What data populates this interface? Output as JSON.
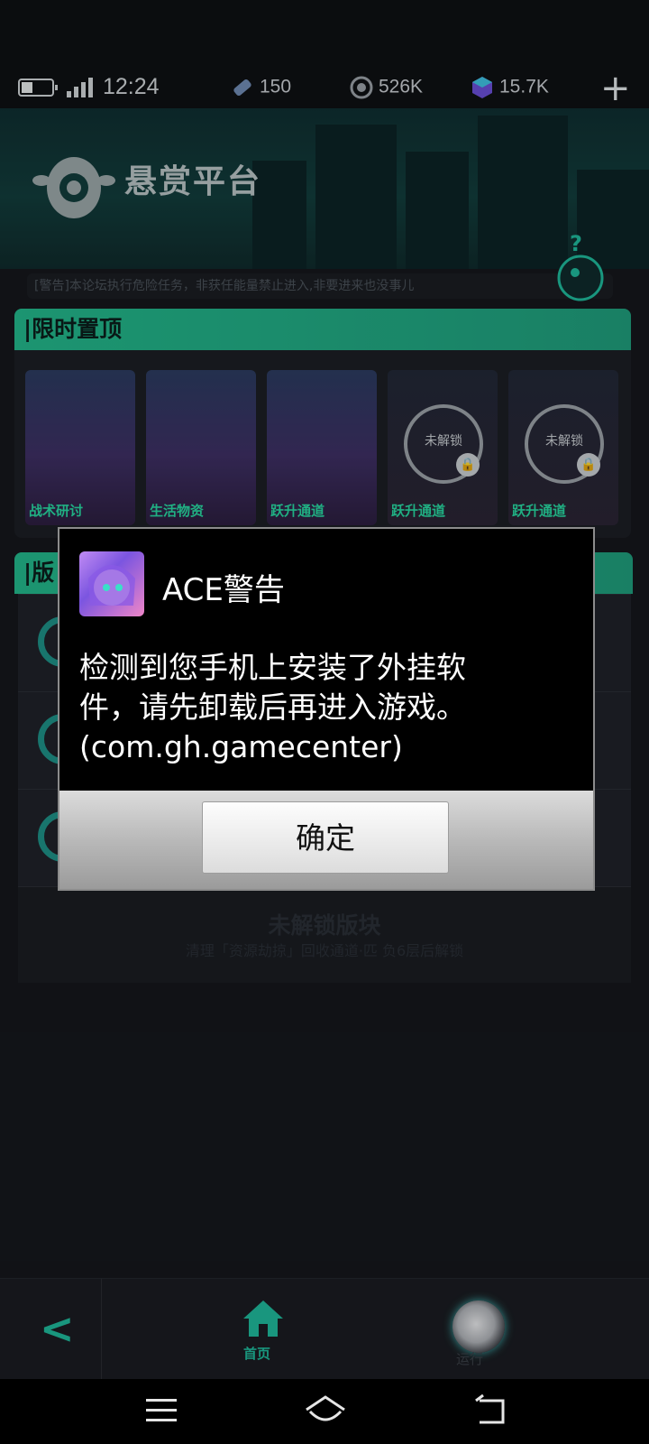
{
  "status_bar": {
    "time": "12:24",
    "battery_level": 0.3,
    "resources": [
      {
        "icon": "ticket-icon",
        "value": "150"
      },
      {
        "icon": "coin-icon",
        "value": "526K"
      },
      {
        "icon": "gem-icon",
        "value": "15.7K"
      }
    ],
    "add_label": "+"
  },
  "banner": {
    "title": "悬赏平台",
    "notice": "[警告]本论坛执行危险任务，非获任能量禁止进入,非要进来也没事儿"
  },
  "pinned": {
    "heading": "|限时置顶",
    "cards": [
      {
        "label": "战术研讨",
        "locked": false
      },
      {
        "label": "生活物资",
        "locked": false
      },
      {
        "label": "跃升通道",
        "locked": false
      },
      {
        "label": "跃升通道",
        "locked": true,
        "lock_text": "未解锁"
      },
      {
        "label": "跃升通道",
        "locked": true,
        "lock_text": "未解锁"
      }
    ]
  },
  "boards": {
    "heading": "|版",
    "locked_title": "未解锁版块",
    "locked_subtitle": "清理「资源劫掠」回收通道·匹 负6层后解锁"
  },
  "dialog": {
    "title": "ACE警告",
    "message_line1": "检测到您手机上安装了外挂软",
    "message_line2": "件，请先卸载后再进入游戏。",
    "message_line3": "(com.gh.gamecenter)",
    "ok_label": "确定"
  },
  "game_nav": {
    "back_label": "<",
    "home_label": "首页",
    "run_label": "运行"
  },
  "colors": {
    "accent": "#1fb79a",
    "section_header": "#23b68a",
    "dialog_bg": "#000000"
  }
}
